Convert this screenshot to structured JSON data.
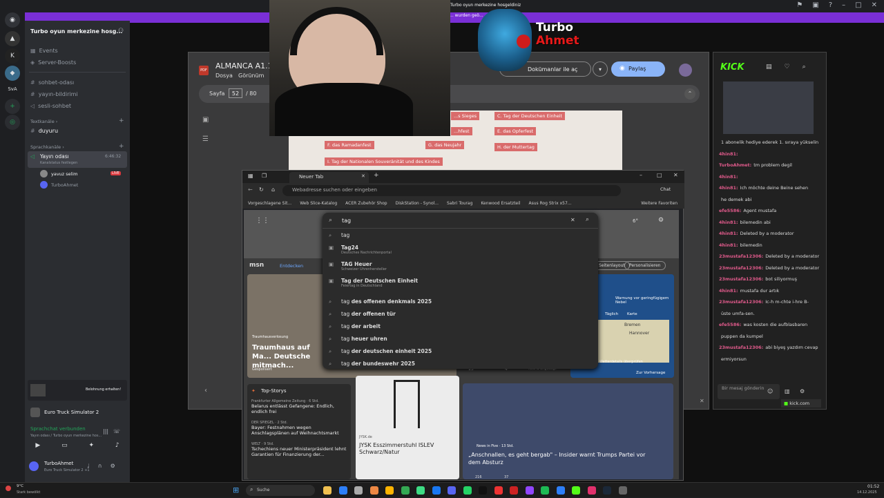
{
  "discord": {
    "server_name": "Turbo oyun merkezine hosg...",
    "events": "Events",
    "boosts": "Server-Boosts",
    "channels": [
      "sohbet-odası",
      "yayın-bildirimi",
      "sesli-sohbet"
    ],
    "cat_text": "Textkanäle",
    "text_channel": "duyuru",
    "cat_voice": "Sprachkanäle",
    "voice_channel": "Yayın odası",
    "voice_sub": "Kanalstatus festlegen",
    "voice_time": "6:46:32",
    "voice_users": [
      "yavuz selim",
      "TurboAhmet"
    ],
    "live_badge": "LIVE",
    "reward": "Belohnung erhalten!",
    "activity": "Euro Truck Simulator 2",
    "connected": "Sprachchat verbunden",
    "connected_sub": "Yayın odası / Turbo oyun merkezine hos...",
    "username": "TurboAhmet",
    "user_status": "Euro Truck Simulator 2 +1",
    "rail_labels": [
      "K",
      "SvA"
    ],
    "notice": "Turbo oyun merkezine hosgeldiniz",
    "notice2": "... wurden geö..."
  },
  "pdf": {
    "title": "ALMANCA A1.1",
    "menu": [
      "Dosya",
      "Görünüm"
    ],
    "page_label": "Sayfa",
    "page_num": "52",
    "page_total": "/ 80",
    "open_btn": "Dokümanlar ile aç",
    "share_btn": "Paylaş",
    "options": [
      "F. das Ramadanfest",
      "G. das Neujahr",
      "H. der Muttertag",
      "I. Tag der Nationalen Souveränität und des Kindes",
      "C. Tag der Deutschen Einheit",
      "E. das Opferfest",
      "...s Sieges",
      "...hfest"
    ]
  },
  "kick": {
    "logo": "KICK",
    "chat": [
      {
        "name": "",
        "text": "1 abonelik hediye ederek 1. sıraya yükselin"
      },
      {
        "name": "4hin81:",
        "text": ""
      },
      {
        "name": "TurboAhmet:",
        "text": "tm problem degil"
      },
      {
        "name": "4hin81:",
        "text": ""
      },
      {
        "name": "4hin81:",
        "text": "Ich möchte deine Beine sehen"
      },
      {
        "name": "",
        "text": "he demek abi"
      },
      {
        "name": "efe5586:",
        "text": "Agent mustafa"
      },
      {
        "name": "4hin81:",
        "text": "bilemedin abi"
      },
      {
        "name": "4hin81:",
        "text": "Deleted by a moderator"
      },
      {
        "name": "4hin81:",
        "text": "bilemedin"
      },
      {
        "name": "23mustafa12306:",
        "text": "Deleted by a moderator"
      },
      {
        "name": "23mustafa12306:",
        "text": "Deleted by a moderator"
      },
      {
        "name": "23mustafa12306:",
        "text": "bot siliyormuş"
      },
      {
        "name": "4hin81:",
        "text": "mustafa dur artık"
      },
      {
        "name": "23mustafa12306:",
        "text": "Ic-h m-chte i-hre B-"
      },
      {
        "name": "",
        "text": "üste umfa-sen."
      },
      {
        "name": "efe5586:",
        "text": "was kosten die aufblasbaren"
      },
      {
        "name": "",
        "text": "puppen da kumpel"
      },
      {
        "name": "23mustafa12306:",
        "text": "abi biyeş yazdım cevap"
      },
      {
        "name": "",
        "text": "ermiyorsun"
      }
    ],
    "input_placeholder": "Bir mesaj gönderin",
    "domain": "kick.com"
  },
  "browser": {
    "tab": "Neuer Tab",
    "address": "Webadresse suchen oder eingeben",
    "chat_btn": "Chat",
    "bookmarks": [
      "Vorgeschlagene Sit...",
      "Web Slice-Katalog",
      "ACER Zubehör Shop",
      "DiskStation - Synol...",
      "Sabri Tourag",
      "Kenwood Ersatzteil",
      "Asus Rog Strix x57..."
    ],
    "fav_more": "Weitere Favoriten",
    "search_text": "tag",
    "weather": "6°",
    "msn": "msn",
    "discover": "Entdecken",
    "layout_btn": "Seitenlayout",
    "personalize": "Personalisieren",
    "suggestions": [
      {
        "pre": "",
        "bold": "",
        "text": "tag",
        "sub": ""
      },
      {
        "pre": "",
        "bold": "",
        "text": "Tag24",
        "sub": "Deutsches Nachrichtenportal"
      },
      {
        "pre": "",
        "bold": "",
        "text": "TAG Heuer",
        "sub": "Schweizer Uhrenhersteller"
      },
      {
        "pre": "",
        "bold": "",
        "text": "Tag der Deutschen Einheit",
        "sub": "Feiertag in Deutschland"
      },
      {
        "pre": "tag ",
        "bold": "des offenen denkmals 2025",
        "text": "",
        "sub": ""
      },
      {
        "pre": "tag ",
        "bold": "der offenen tür",
        "text": "",
        "sub": ""
      },
      {
        "pre": "tag ",
        "bold": "der arbeit",
        "text": "",
        "sub": ""
      },
      {
        "pre": "tag ",
        "bold": "heuer uhren",
        "text": "",
        "sub": ""
      },
      {
        "pre": "tag ",
        "bold": "der deutschen einheit 2025",
        "text": "",
        "sub": ""
      },
      {
        "pre": "tag ",
        "bold": "der bundeswehr 2025",
        "text": "",
        "sub": ""
      }
    ],
    "hero_title": "Traumhaus auf Ma... Deutsche mitmach...",
    "hero_tag": "Traumhausverlosung",
    "sponsored": "Gesponsert",
    "top_stories": "Top-Storys",
    "stories": [
      {
        "src": "Frankfurter Allgemeine Zeitung · 6 Std.",
        "title": "Belarus entlässt Gefangene: Endlich, endlich frei"
      },
      {
        "src": "DER SPIEGEL · 2 Std.",
        "title": "Bayer: Festnahmen wegen Anschlagsplänen auf Weihnachtsmarkt"
      },
      {
        "src": "WELT · 9 Std.",
        "title": "Tschechiens neuer Ministerpräsident lehnt Garantien für Finanzierung der..."
      }
    ],
    "ad_src": "JYSK.de",
    "ad_title": "JYSK Esszimmerstuhl ISLEV Schwarz/Natur",
    "news_src": "News in Five · 13 Std.",
    "news_title": "„Anschnallen, es geht bergab\" – Insider warnt Trumps Partei vor dem Absturz",
    "weather_warn": "Warnung vor geringfügigem Nebel",
    "weather_tabs": [
      "Täglich",
      "Karte"
    ],
    "map_cities": [
      "Bremen",
      "Hannover"
    ],
    "forecast": "Zur Vorhersage",
    "likes": "13",
    "comments": "4",
    "weather_link": "Wetterdetails überprüfen",
    "news_likes": "216",
    "news_comments": "37",
    "share_text": "Neu & angesagt"
  },
  "logo": {
    "line1": "Turbo",
    "line2": "Ahmet"
  },
  "taskbar": {
    "search": "Suche",
    "time": "01:52",
    "date": "14.12.2025",
    "weather": "9°C",
    "weather_sub": "Stark bewölkt"
  }
}
